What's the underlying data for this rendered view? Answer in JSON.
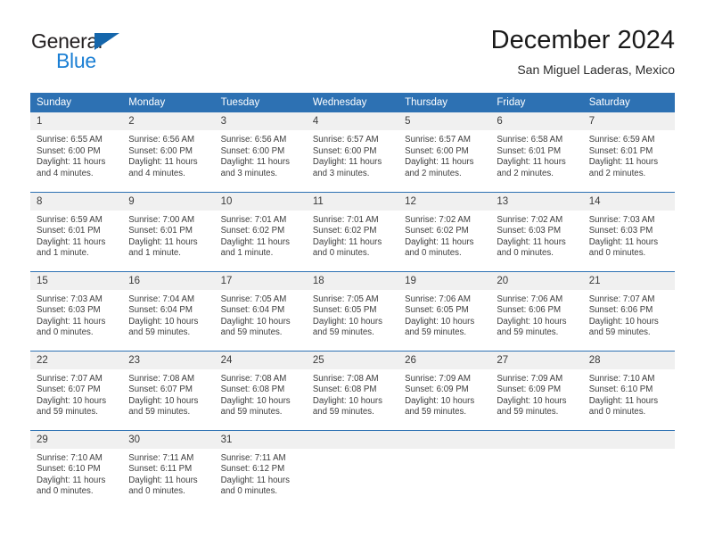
{
  "brand": {
    "name_primary": "General",
    "name_secondary": "Blue",
    "primary_color": "#231f20",
    "secondary_color": "#1b7fd4",
    "triangle_color": "#1566ab"
  },
  "header": {
    "title": "December 2024",
    "subtitle": "San Miguel Laderas, Mexico"
  },
  "theme": {
    "header_bg": "#2d71b3",
    "header_text": "#ffffff",
    "daynum_bg": "#f0f0f0",
    "rule_color": "#2d71b3",
    "body_text": "#3d3d3d"
  },
  "weekday_headers": [
    "Sunday",
    "Monday",
    "Tuesday",
    "Wednesday",
    "Thursday",
    "Friday",
    "Saturday"
  ],
  "labels": {
    "sunrise_prefix": "Sunrise:",
    "sunset_prefix": "Sunset:",
    "daylight_prefix": "Daylight:"
  },
  "weeks": [
    [
      {
        "day": "1",
        "sunrise": "Sunrise: 6:55 AM",
        "sunset": "Sunset: 6:00 PM",
        "daylight_1": "Daylight: 11 hours",
        "daylight_2": "and 4 minutes."
      },
      {
        "day": "2",
        "sunrise": "Sunrise: 6:56 AM",
        "sunset": "Sunset: 6:00 PM",
        "daylight_1": "Daylight: 11 hours",
        "daylight_2": "and 4 minutes."
      },
      {
        "day": "3",
        "sunrise": "Sunrise: 6:56 AM",
        "sunset": "Sunset: 6:00 PM",
        "daylight_1": "Daylight: 11 hours",
        "daylight_2": "and 3 minutes."
      },
      {
        "day": "4",
        "sunrise": "Sunrise: 6:57 AM",
        "sunset": "Sunset: 6:00 PM",
        "daylight_1": "Daylight: 11 hours",
        "daylight_2": "and 3 minutes."
      },
      {
        "day": "5",
        "sunrise": "Sunrise: 6:57 AM",
        "sunset": "Sunset: 6:00 PM",
        "daylight_1": "Daylight: 11 hours",
        "daylight_2": "and 2 minutes."
      },
      {
        "day": "6",
        "sunrise": "Sunrise: 6:58 AM",
        "sunset": "Sunset: 6:01 PM",
        "daylight_1": "Daylight: 11 hours",
        "daylight_2": "and 2 minutes."
      },
      {
        "day": "7",
        "sunrise": "Sunrise: 6:59 AM",
        "sunset": "Sunset: 6:01 PM",
        "daylight_1": "Daylight: 11 hours",
        "daylight_2": "and 2 minutes."
      }
    ],
    [
      {
        "day": "8",
        "sunrise": "Sunrise: 6:59 AM",
        "sunset": "Sunset: 6:01 PM",
        "daylight_1": "Daylight: 11 hours",
        "daylight_2": "and 1 minute."
      },
      {
        "day": "9",
        "sunrise": "Sunrise: 7:00 AM",
        "sunset": "Sunset: 6:01 PM",
        "daylight_1": "Daylight: 11 hours",
        "daylight_2": "and 1 minute."
      },
      {
        "day": "10",
        "sunrise": "Sunrise: 7:01 AM",
        "sunset": "Sunset: 6:02 PM",
        "daylight_1": "Daylight: 11 hours",
        "daylight_2": "and 1 minute."
      },
      {
        "day": "11",
        "sunrise": "Sunrise: 7:01 AM",
        "sunset": "Sunset: 6:02 PM",
        "daylight_1": "Daylight: 11 hours",
        "daylight_2": "and 0 minutes."
      },
      {
        "day": "12",
        "sunrise": "Sunrise: 7:02 AM",
        "sunset": "Sunset: 6:02 PM",
        "daylight_1": "Daylight: 11 hours",
        "daylight_2": "and 0 minutes."
      },
      {
        "day": "13",
        "sunrise": "Sunrise: 7:02 AM",
        "sunset": "Sunset: 6:03 PM",
        "daylight_1": "Daylight: 11 hours",
        "daylight_2": "and 0 minutes."
      },
      {
        "day": "14",
        "sunrise": "Sunrise: 7:03 AM",
        "sunset": "Sunset: 6:03 PM",
        "daylight_1": "Daylight: 11 hours",
        "daylight_2": "and 0 minutes."
      }
    ],
    [
      {
        "day": "15",
        "sunrise": "Sunrise: 7:03 AM",
        "sunset": "Sunset: 6:03 PM",
        "daylight_1": "Daylight: 11 hours",
        "daylight_2": "and 0 minutes."
      },
      {
        "day": "16",
        "sunrise": "Sunrise: 7:04 AM",
        "sunset": "Sunset: 6:04 PM",
        "daylight_1": "Daylight: 10 hours",
        "daylight_2": "and 59 minutes."
      },
      {
        "day": "17",
        "sunrise": "Sunrise: 7:05 AM",
        "sunset": "Sunset: 6:04 PM",
        "daylight_1": "Daylight: 10 hours",
        "daylight_2": "and 59 minutes."
      },
      {
        "day": "18",
        "sunrise": "Sunrise: 7:05 AM",
        "sunset": "Sunset: 6:05 PM",
        "daylight_1": "Daylight: 10 hours",
        "daylight_2": "and 59 minutes."
      },
      {
        "day": "19",
        "sunrise": "Sunrise: 7:06 AM",
        "sunset": "Sunset: 6:05 PM",
        "daylight_1": "Daylight: 10 hours",
        "daylight_2": "and 59 minutes."
      },
      {
        "day": "20",
        "sunrise": "Sunrise: 7:06 AM",
        "sunset": "Sunset: 6:06 PM",
        "daylight_1": "Daylight: 10 hours",
        "daylight_2": "and 59 minutes."
      },
      {
        "day": "21",
        "sunrise": "Sunrise: 7:07 AM",
        "sunset": "Sunset: 6:06 PM",
        "daylight_1": "Daylight: 10 hours",
        "daylight_2": "and 59 minutes."
      }
    ],
    [
      {
        "day": "22",
        "sunrise": "Sunrise: 7:07 AM",
        "sunset": "Sunset: 6:07 PM",
        "daylight_1": "Daylight: 10 hours",
        "daylight_2": "and 59 minutes."
      },
      {
        "day": "23",
        "sunrise": "Sunrise: 7:08 AM",
        "sunset": "Sunset: 6:07 PM",
        "daylight_1": "Daylight: 10 hours",
        "daylight_2": "and 59 minutes."
      },
      {
        "day": "24",
        "sunrise": "Sunrise: 7:08 AM",
        "sunset": "Sunset: 6:08 PM",
        "daylight_1": "Daylight: 10 hours",
        "daylight_2": "and 59 minutes."
      },
      {
        "day": "25",
        "sunrise": "Sunrise: 7:08 AM",
        "sunset": "Sunset: 6:08 PM",
        "daylight_1": "Daylight: 10 hours",
        "daylight_2": "and 59 minutes."
      },
      {
        "day": "26",
        "sunrise": "Sunrise: 7:09 AM",
        "sunset": "Sunset: 6:09 PM",
        "daylight_1": "Daylight: 10 hours",
        "daylight_2": "and 59 minutes."
      },
      {
        "day": "27",
        "sunrise": "Sunrise: 7:09 AM",
        "sunset": "Sunset: 6:09 PM",
        "daylight_1": "Daylight: 10 hours",
        "daylight_2": "and 59 minutes."
      },
      {
        "day": "28",
        "sunrise": "Sunrise: 7:10 AM",
        "sunset": "Sunset: 6:10 PM",
        "daylight_1": "Daylight: 11 hours",
        "daylight_2": "and 0 minutes."
      }
    ],
    [
      {
        "day": "29",
        "sunrise": "Sunrise: 7:10 AM",
        "sunset": "Sunset: 6:10 PM",
        "daylight_1": "Daylight: 11 hours",
        "daylight_2": "and 0 minutes."
      },
      {
        "day": "30",
        "sunrise": "Sunrise: 7:11 AM",
        "sunset": "Sunset: 6:11 PM",
        "daylight_1": "Daylight: 11 hours",
        "daylight_2": "and 0 minutes."
      },
      {
        "day": "31",
        "sunrise": "Sunrise: 7:11 AM",
        "sunset": "Sunset: 6:12 PM",
        "daylight_1": "Daylight: 11 hours",
        "daylight_2": "and 0 minutes."
      },
      {
        "day": "",
        "sunrise": "",
        "sunset": "",
        "daylight_1": "",
        "daylight_2": ""
      },
      {
        "day": "",
        "sunrise": "",
        "sunset": "",
        "daylight_1": "",
        "daylight_2": ""
      },
      {
        "day": "",
        "sunrise": "",
        "sunset": "",
        "daylight_1": "",
        "daylight_2": ""
      },
      {
        "day": "",
        "sunrise": "",
        "sunset": "",
        "daylight_1": "",
        "daylight_2": ""
      }
    ]
  ]
}
